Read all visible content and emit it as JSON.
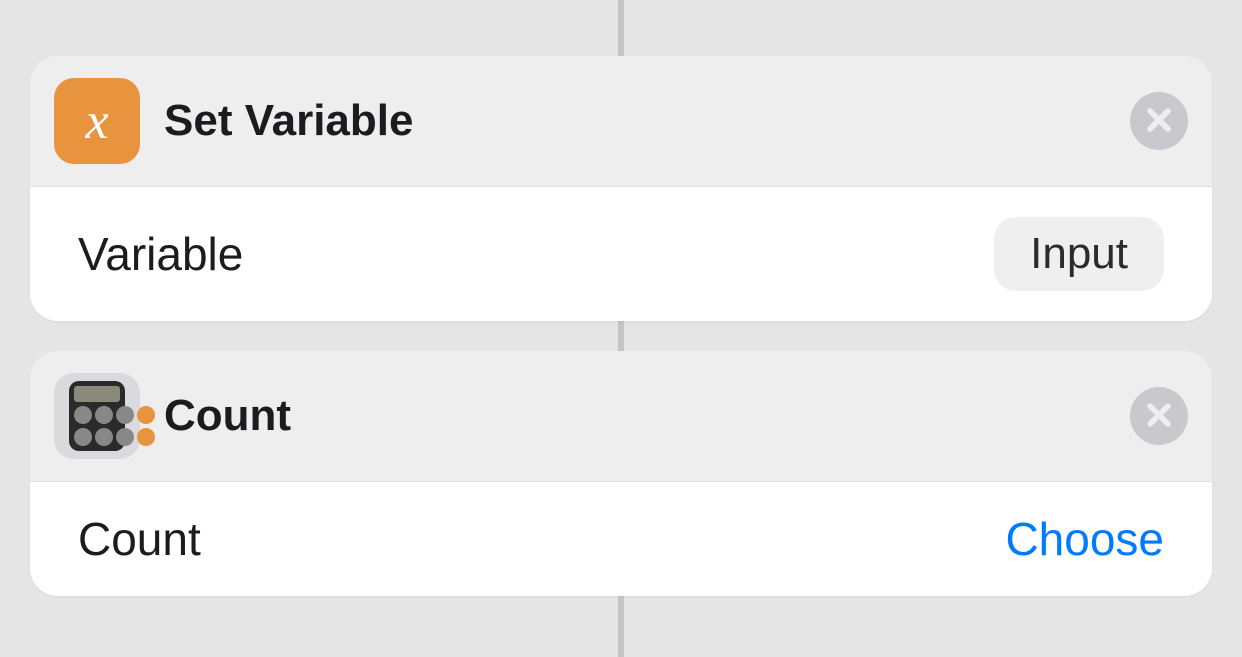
{
  "actions": [
    {
      "id": "set-variable",
      "title": "Set Variable",
      "icon": "variable-x-icon",
      "param_label": "Variable",
      "value_type": "token",
      "value": "Input"
    },
    {
      "id": "count",
      "title": "Count",
      "icon": "calculator-icon",
      "param_label": "Count",
      "value_type": "link",
      "value": "Choose"
    }
  ]
}
